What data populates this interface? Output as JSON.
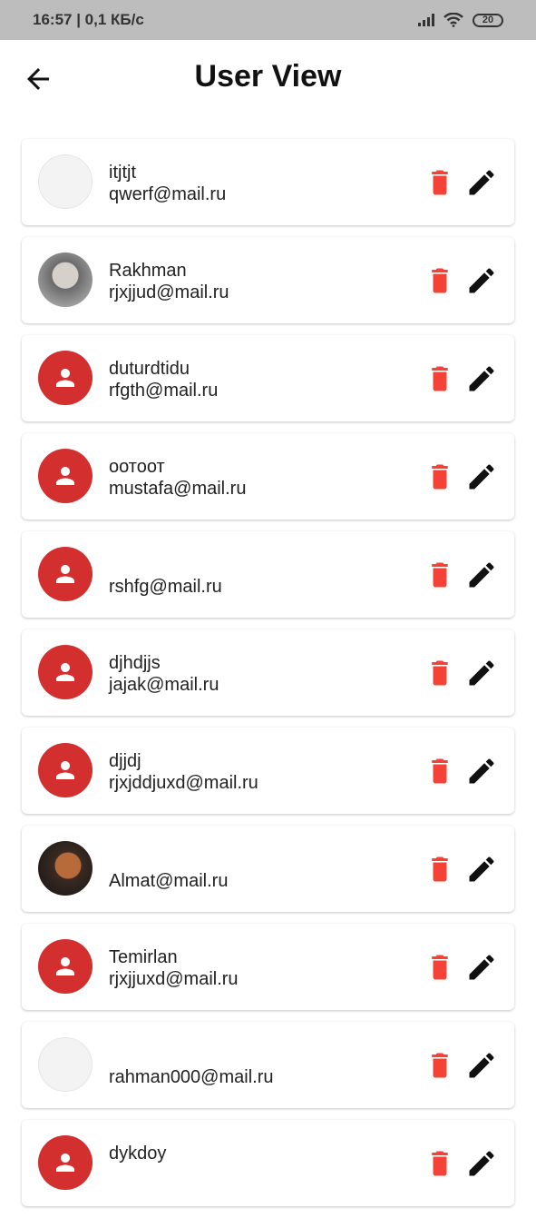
{
  "status_bar": {
    "time_speed": "16:57 | 0,1 КБ/с",
    "battery": "20"
  },
  "app_bar": {
    "title": "User View",
    "back_icon": "arrow-left-icon"
  },
  "colors": {
    "accent_red": "#d32f2f",
    "delete_red": "#f44336",
    "status_bar_bg": "#bdbdbd"
  },
  "users": [
    {
      "name": "itjtjt",
      "email": "qwerf@mail.ru",
      "avatar": "photo"
    },
    {
      "name": "Rakhman",
      "email": "rjxjjud@mail.ru",
      "avatar": "photo"
    },
    {
      "name": "duturdtidu",
      "email": "rfgth@mail.ru",
      "avatar": "default"
    },
    {
      "name": "оотоот",
      "email": "mustafa@mail.ru",
      "avatar": "default"
    },
    {
      "name": "",
      "email": "rshfg@mail.ru",
      "avatar": "default"
    },
    {
      "name": "djhdjjs",
      "email": "jajak@mail.ru",
      "avatar": "default"
    },
    {
      "name": "djjdj",
      "email": "rjxjddjuxd@mail.ru",
      "avatar": "default"
    },
    {
      "name": "",
      "email": "Almat@mail.ru",
      "avatar": "photo"
    },
    {
      "name": "Temirlan",
      "email": "rjxjjuxd@mail.ru",
      "avatar": "default"
    },
    {
      "name": "",
      "email": "rahman000@mail.ru",
      "avatar": "photo"
    },
    {
      "name": "dykdoy",
      "email": "",
      "avatar": "default"
    }
  ]
}
